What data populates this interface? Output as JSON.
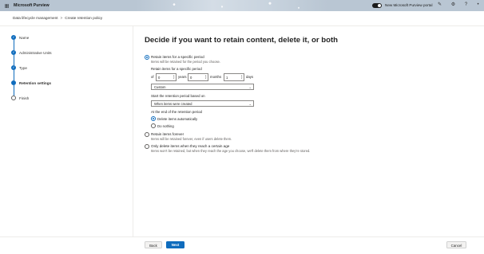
{
  "app": {
    "name": "Microsoft Purview",
    "portal_toggle_label": "New Microsoft Purview portal",
    "top_icons": [
      "edit-icon",
      "settings-icon",
      "help-icon",
      "account-icon"
    ]
  },
  "breadcrumb": {
    "items": [
      "Data lifecycle management",
      "Create retention policy"
    ],
    "separator": ">"
  },
  "wizard": {
    "steps": [
      {
        "label": "Name",
        "status": "done"
      },
      {
        "label": "Administrative Units",
        "status": "done"
      },
      {
        "label": "Type",
        "status": "done"
      },
      {
        "label": "Retention settings",
        "status": "current"
      },
      {
        "label": "Finish",
        "status": "pending"
      }
    ]
  },
  "main": {
    "title": "Decide if you want to retain content, delete it, or both",
    "option_retain_period": {
      "label": "Retain items for a specific period",
      "description": "Items will be retained for the period you choose.",
      "selected": true
    },
    "retain_period": {
      "label": "Retain items for a specific period",
      "of_label": "of",
      "years_value": "0",
      "years_label": "years",
      "months_value": "0",
      "months_label": "months",
      "days_value": "1",
      "days_label": "days",
      "preset_value": "Custom"
    },
    "start_based_on": {
      "label": "Start the retention period based on",
      "value": "When items were created"
    },
    "end_of_period": {
      "label": "At the end of the retention period",
      "delete_auto": {
        "label": "Delete items automatically",
        "selected": true
      },
      "do_nothing": {
        "label": "Do nothing",
        "selected": false
      }
    },
    "option_retain_forever": {
      "label": "Retain items forever",
      "description": "Items will be retained forever, even if users delete them.",
      "selected": false
    },
    "option_delete_only": {
      "label": "Only delete items when they reach a certain age",
      "description": "Items won't be retained, but when they reach the age you choose, we'll delete them from where they're stored.",
      "selected": false
    }
  },
  "footer": {
    "back_label": "Back",
    "next_label": "Next",
    "cancel_label": "Cancel"
  },
  "colors": {
    "accent": "#0f6cbd",
    "topbar": "#b9c6d3"
  }
}
